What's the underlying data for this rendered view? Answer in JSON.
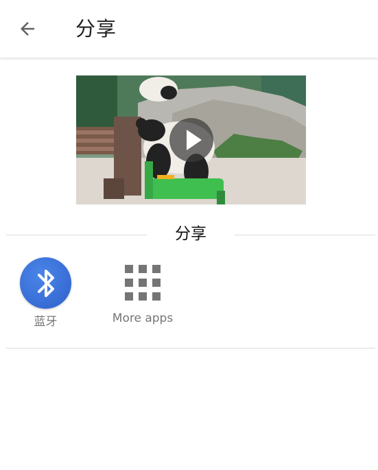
{
  "header": {
    "title": "分享",
    "back_icon": "arrow-back-icon"
  },
  "preview": {
    "type": "video",
    "play_icon": "play-icon"
  },
  "share_section": {
    "title": "分享",
    "targets": [
      {
        "label": "蓝牙",
        "icon": "bluetooth-icon",
        "color": "#3a6fd8"
      },
      {
        "label": "More apps",
        "icon": "apps-grid-icon",
        "color": "#757575"
      }
    ]
  }
}
